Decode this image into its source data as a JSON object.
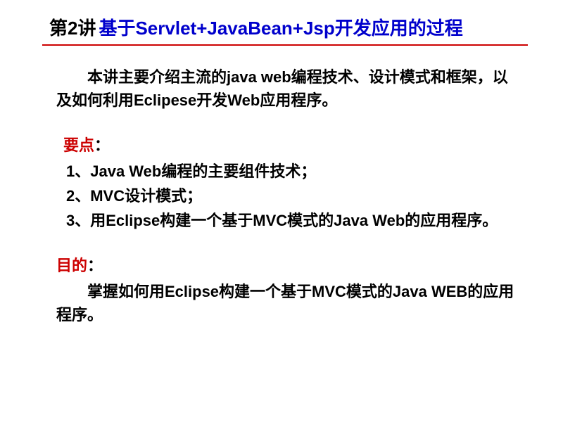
{
  "title": {
    "prefix": "第2讲",
    "main": "基于Servlet+JavaBean+Jsp开发应用的过程"
  },
  "intro": "本讲主要介绍主流的java web编程技术、设计模式和框架，以及如何利用Eclipese开发Web应用程序。",
  "points": {
    "label": "要点",
    "colon": "：",
    "items": [
      "1、Java Web编程的主要组件技术；",
      "2、MVC设计模式；",
      "3、用Eclipse构建一个基于MVC模式的Java Web的应用程序。"
    ]
  },
  "purpose": {
    "label": "目的",
    "colon": "：",
    "text": "掌握如何用Eclipse构建一个基于MVC模式的Java WEB的应用程序。"
  }
}
